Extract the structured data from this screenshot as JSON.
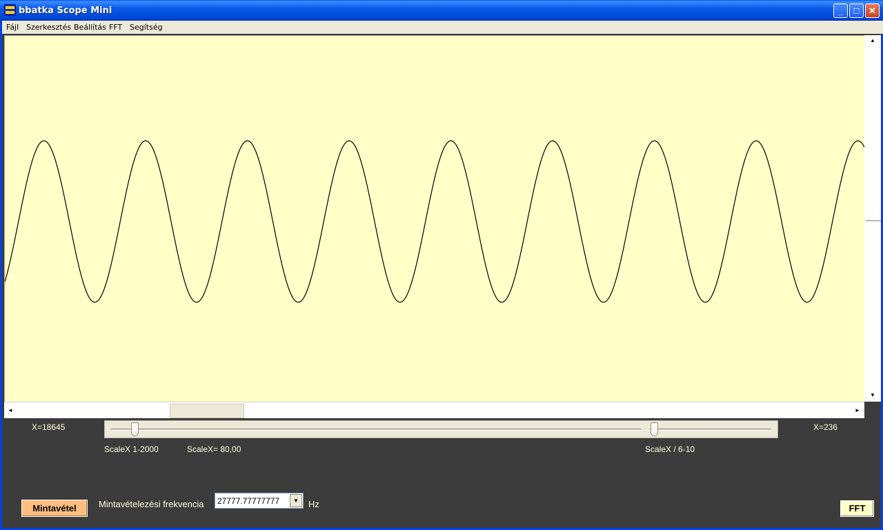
{
  "window": {
    "title": "bbatka Scope Mini",
    "minimize_label": "_",
    "maximize_label": "□",
    "close_label": "✕"
  },
  "menu": [
    "Fájl",
    "Szerkesztés",
    "Beállítás",
    "FFT",
    "Segítség"
  ],
  "plot": {
    "background": "#ffffc8",
    "trace_color": "#000000",
    "cycles_visible": 8.5,
    "level": {
      "max": 0.5,
      "min": -0.5
    }
  },
  "scroll": {
    "up": "▲",
    "down": "▼",
    "left": "◄",
    "right": "►"
  },
  "controls": {
    "x_left": "X=18645",
    "x_right": "X=236",
    "scale_range": "ScaleX 1-2000",
    "scale_value": "ScaleX= 80,00",
    "scale_div": "ScaleX / 6-10",
    "sample_button": "Mintavétel",
    "freq_label": "Mintavételezési frekvencia",
    "freq_value": "27777.77777777",
    "freq_unit": "Hz",
    "fft_button": "FFT"
  },
  "colors": {
    "titlebar": "#0a5ae8",
    "panel": "#3c3c3c",
    "sample_button": "#ffbe80",
    "label_text": "#ffffe0"
  }
}
